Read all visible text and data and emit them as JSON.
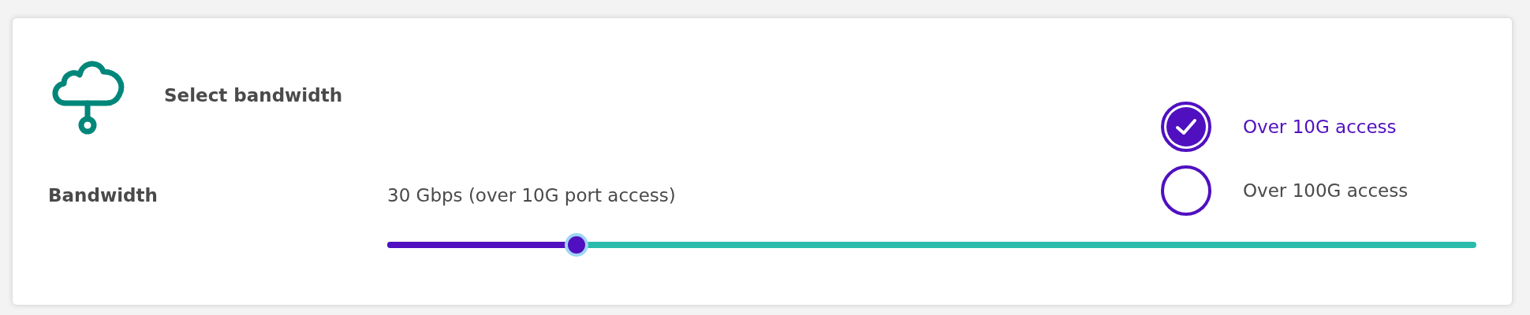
{
  "header": {
    "title": "Select bandwidth"
  },
  "bandwidth": {
    "label": "Bandwidth",
    "value": "30 Gbps (over 10G port access)",
    "level": 0.174
  },
  "access_options": [
    {
      "label": "Over 10G access",
      "selected": true
    },
    {
      "label": "Over 100G access",
      "selected": false
    }
  ]
}
